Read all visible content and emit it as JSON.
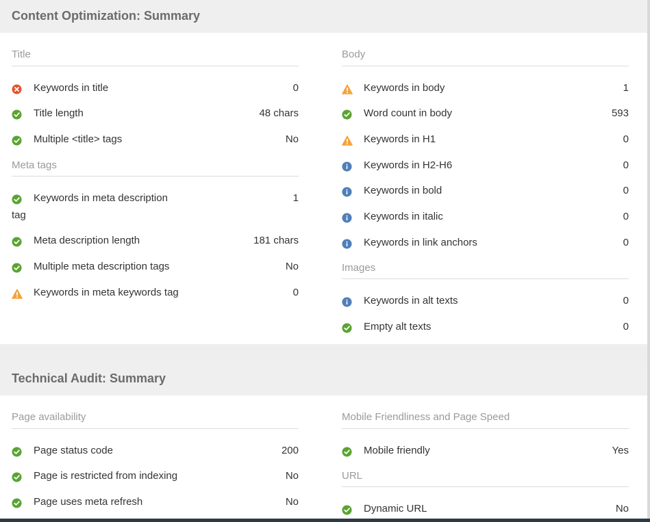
{
  "content": {
    "title": "Content Optimization: Summary",
    "left": {
      "title_section": "Title",
      "title_rows": [
        {
          "label": "Keywords in title",
          "value": "0",
          "icon": "error-icon"
        },
        {
          "label": "Title length",
          "value": "48 chars",
          "icon": "check-icon"
        },
        {
          "label": "Multiple <title> tags",
          "value": "No",
          "icon": "check-icon"
        }
      ],
      "meta_section": "Meta tags",
      "meta_rows": [
        {
          "label": "Keywords in meta description",
          "label_cont": "tag",
          "value": "1",
          "icon": "check-icon"
        },
        {
          "label": "Meta description length",
          "value": "181 chars",
          "icon": "check-icon"
        },
        {
          "label": "Multiple meta description tags",
          "value": "No",
          "icon": "check-icon"
        },
        {
          "label": "Keywords in meta keywords tag",
          "value": "0",
          "icon": "warning-icon"
        }
      ]
    },
    "right": {
      "body_section": "Body",
      "body_rows": [
        {
          "label": "Keywords in body",
          "value": "1",
          "icon": "warning-icon"
        },
        {
          "label": "Word count in body",
          "value": "593",
          "icon": "check-icon"
        },
        {
          "label": "Keywords in H1",
          "value": "0",
          "icon": "warning-icon"
        },
        {
          "label": "Keywords in H2-H6",
          "value": "0",
          "icon": "info-icon"
        },
        {
          "label": "Keywords in bold",
          "value": "0",
          "icon": "info-icon"
        },
        {
          "label": "Keywords in italic",
          "value": "0",
          "icon": "info-icon"
        },
        {
          "label": "Keywords in link anchors",
          "value": "0",
          "icon": "info-icon"
        }
      ],
      "images_section": "Images",
      "images_rows": [
        {
          "label": "Keywords in alt texts",
          "value": "0",
          "icon": "info-icon"
        },
        {
          "label": "Empty alt texts",
          "value": "0",
          "icon": "check-icon"
        }
      ]
    }
  },
  "technical": {
    "title": "Technical Audit: Summary",
    "left": {
      "availability_section": "Page availability",
      "availability_rows": [
        {
          "label": "Page status code",
          "value": "200",
          "icon": "check-icon"
        },
        {
          "label": "Page is restricted from indexing",
          "value": "No",
          "icon": "check-icon"
        },
        {
          "label": "Page uses meta refresh",
          "value": "No",
          "icon": "check-icon"
        }
      ]
    },
    "right": {
      "mobile_section": "Mobile Friendliness and Page Speed",
      "mobile_rows": [
        {
          "label": "Mobile friendly",
          "value": "Yes",
          "icon": "check-icon"
        }
      ],
      "url_section": "URL",
      "url_rows": [
        {
          "label": "Dynamic URL",
          "value": "No",
          "icon": "check-icon"
        }
      ]
    }
  },
  "colors": {
    "check": "#5aa432",
    "error": "#e5532d",
    "warning": "#f5a33b",
    "info": "#4f7fb8"
  }
}
